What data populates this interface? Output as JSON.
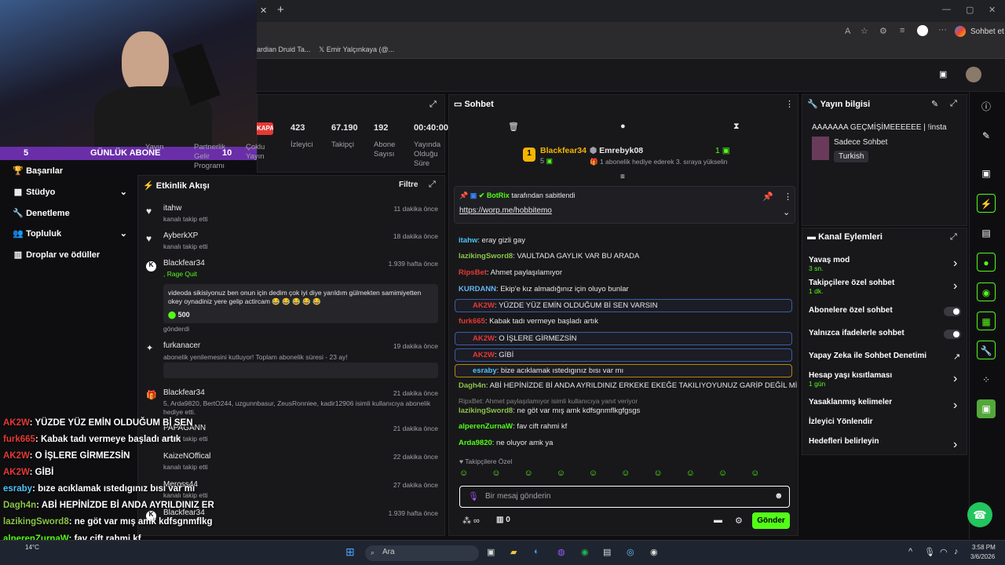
{
  "browser": {
    "tab_close": "✕",
    "tab_add": "+",
    "bookmark1": "ardian Druid Ta...",
    "bookmark2": "Emir Yalçınkaya (@...",
    "chat_label": "Sohbet et"
  },
  "webcam": {
    "subs_count": "5",
    "daily_sub_label": "GÜNLÜK ABONE",
    "daily_sub_count": "10"
  },
  "left_menu": [
    {
      "label": "Başarılar",
      "icon": "trophy-icon"
    },
    {
      "label": "Stüdyo",
      "icon": "studio-icon",
      "chevron": true
    },
    {
      "label": "Denetleme",
      "icon": "wrench-icon"
    },
    {
      "label": "Topluluk",
      "icon": "community-icon",
      "chevron": true
    },
    {
      "label": "Droplar ve ödüller",
      "icon": "drops-icon"
    }
  ],
  "stats": {
    "items": [
      {
        "value": "KAPALI",
        "label": ""
      },
      {
        "value": "423",
        "label": "İzleyici"
      },
      {
        "value": "67.190",
        "label": "Takipçi"
      },
      {
        "value": "192",
        "label": "Abone Sayısı"
      },
      {
        "value": "00:40:00",
        "label": "Yayında Olduğu Süre"
      }
    ],
    "partial_labels": [
      "Yayın",
      "Partnerlik Gelir Programı",
      "Çoklu Yayın"
    ]
  },
  "activity": {
    "title": "Etkinlik Akışı",
    "filter": "Filtre",
    "items": [
      {
        "user": "itahw",
        "desc": "kanalı takip etti",
        "time": "11 dakika önce",
        "icon": "heart-icon"
      },
      {
        "user": "AyberkXP",
        "desc": "kanalı takip etti",
        "time": "18 dakika önce",
        "icon": "heart-icon"
      },
      {
        "user": "Blackfear34",
        "desc": ", Rage Quit",
        "time": "1.939 hafta önce",
        "icon": "kick-icon",
        "message": "videoda sikisiyonuz ben onun için dedim çok iyi diye yarıldım gülmekten samimiyetten okey oynadiniz yere gelip actircam 😂 😂 😂 😂 😂",
        "amount": "500",
        "sent": "gönderdi"
      },
      {
        "user": "furkanacer",
        "desc": "abonelik yenilemesini kutluyor! Toplam abonelik süresi - 23 ay!",
        "time": "19 dakika önce",
        "icon": "star-icon"
      },
      {
        "user": "Blackfear34",
        "desc": "5, Arda9820, BertO244, uzgunnbasur, ZeusRonniee, kadir12906 isimli kullanıcıya abonelik hediye etti.",
        "time": "21 dakika önce",
        "icon": "gift-icon"
      },
      {
        "user": "PAPAGANN",
        "desc": "kanalı takip etti",
        "time": "21 dakika önce",
        "icon": "heart-icon"
      },
      {
        "user": "KaizeNOffical",
        "desc": "kanalı takip etti",
        "time": "22 dakika önce",
        "icon": "heart-icon"
      },
      {
        "user": "Meross44",
        "desc": "kanalı takip etti",
        "time": "27 dakika önce",
        "icon": "heart-icon"
      },
      {
        "user": "Blackfear34",
        "desc": "",
        "time": "1.939 hafta önce",
        "icon": "kick-icon"
      }
    ]
  },
  "chat": {
    "title": "Sohbet",
    "gifter1": "Blackfear34",
    "gifter1_count": "5",
    "gifter2": "Emrebyk08",
    "gifter2_count": "1",
    "gifter2_desc": "1 abonelik hediye ederek 3. sıraya yükselin",
    "pinned_by": "BotRix",
    "pinned_suffix": "tarafından sabitlendi",
    "pinned_link": "https://worp.me/hobbitemo",
    "messages": [
      {
        "user": "itahw",
        "text": ": eray gizli gay",
        "color": "#4fc3f7"
      },
      {
        "user": "lazikingSword8",
        "text": ": VAULTADA GAYLIK VAR BU ARADA",
        "color": "#8bc34a"
      },
      {
        "user": "RipsBet",
        "text": ": Ahmet paylaşılamıyor",
        "color": "#e53935"
      },
      {
        "user": "KURDANN",
        "text": ": Ekip'e kız almadığınız için oluyo bunlar",
        "color": "#64b5f6"
      },
      {
        "user": "AK2W",
        "text": ": YÜZDE YÜZ EMİN OLDUĞUM Bİ SEN VARSIN",
        "color": "#e53935",
        "box": true
      },
      {
        "user": "furk665",
        "text": ": Kabak tadı vermeye başladı artık",
        "color": "#e53935"
      },
      {
        "user": "AK2W",
        "text": ": O İŞLERE GİRMEZSİN",
        "color": "#e53935",
        "box": true
      },
      {
        "user": "AK2W",
        "text": ": GİBİ",
        "color": "#e53935",
        "box": true
      },
      {
        "user": "esraby",
        "text": ": bize acıklamak ıstedıgınız bısı var mı",
        "color": "#4fc3f7",
        "box": true
      },
      {
        "user": "Dagh4n",
        "text": ": ABİ HEPİNİZDE Bİ ANDA AYRILDINIZ ERKEKE EKEĞE TAKILIYOYUNUZ GARİP DEĞİL Mİ",
        "color": "#8bc34a"
      },
      {
        "user": "",
        "text": "RipxBet: Ahmet paylaşılamıyor isimli kullanıcıya yanıt veriyor",
        "color": "#888"
      },
      {
        "user": "lazikingSword8",
        "text": ": ne göt var mış amk kdfsgnmflkgfgsgs",
        "color": "#8bc34a"
      },
      {
        "user": "alperenZurnaW",
        "text": ": fav cift rahmi kf",
        "color": "#53fc18"
      },
      {
        "user": "Arda9820",
        "text": ": ne oluyor amk ya",
        "color": "#53fc18"
      }
    ],
    "followers_only": "Takipçilere Özel",
    "input_placeholder": "Bir mesaj gönderin",
    "points": "0",
    "send": "Gönder"
  },
  "stream_info": {
    "title": "Yayın bilgisi",
    "stream_title": "AAAAAAA GEÇMİŞİMEEEEEE | !insta",
    "category": "Sadece Sohbet",
    "language": "Turkish"
  },
  "channel_actions": {
    "title": "Kanal Eylemleri",
    "items": [
      {
        "label": "Yavaş mod",
        "sub": "3 sn.",
        "type": "arrow"
      },
      {
        "label": "Takipçilere özel sohbet",
        "sub": "1 dk.",
        "type": "arrow"
      },
      {
        "label": "Abonelere özel sohbet",
        "sub": "",
        "type": "toggle"
      },
      {
        "label": "Yalnızca ifadelerle sohbet",
        "sub": "",
        "type": "toggle"
      },
      {
        "label": "Yapay Zeka ile Sohbet Denetimi",
        "sub": "",
        "type": "link"
      },
      {
        "label": "Hesap yaşı kısıtlaması",
        "sub": "1 gün",
        "type": "arrow"
      },
      {
        "label": "Yasaklanmış kelimeler",
        "sub": "",
        "type": "arrow"
      },
      {
        "label": "İzleyici Yönlendir",
        "sub": "",
        "type": "none"
      },
      {
        "label": "Hedefleri belirleyin",
        "sub": "",
        "type": "arrow"
      }
    ]
  },
  "overlay_chat": [
    {
      "user": "AK2W",
      "text": ": YÜZDE YÜZ EMİN OLDUĞUM Bİ SEN",
      "color": "#e53935"
    },
    {
      "user": "furk665",
      "text": ": Kabak tadı vermeye başladı artık",
      "color": "#e53935"
    },
    {
      "user": "AK2W",
      "text": ": O İŞLERE GİRMEZSİN",
      "color": "#e53935"
    },
    {
      "user": "AK2W",
      "text": ": GİBİ",
      "color": "#e53935"
    },
    {
      "user": "esraby",
      "text": ": bıze acıklamak ıstedıgınız bısı var mı",
      "color": "#4fc3f7"
    },
    {
      "user": "Dagh4n",
      "text": ": ABİ HEPİNİZDE Bİ ANDA AYRILDINIZ ER",
      "color": "#8bc34a"
    },
    {
      "user": "lazikingSword8",
      "text": ": ne göt var mış amk kdfsgnmflkg",
      "color": "#8bc34a"
    },
    {
      "user": "alperenZurnaW",
      "text": ": fav cift rahmi kf",
      "color": "#53fc18"
    },
    {
      "user": "Arda9820",
      "text": ": ne oluyor amk ya",
      "color": "#53fc18"
    }
  ],
  "taskbar": {
    "temp": "14°C",
    "search": "Ara",
    "time": "3:58 PM",
    "date": "3/6/2026"
  }
}
